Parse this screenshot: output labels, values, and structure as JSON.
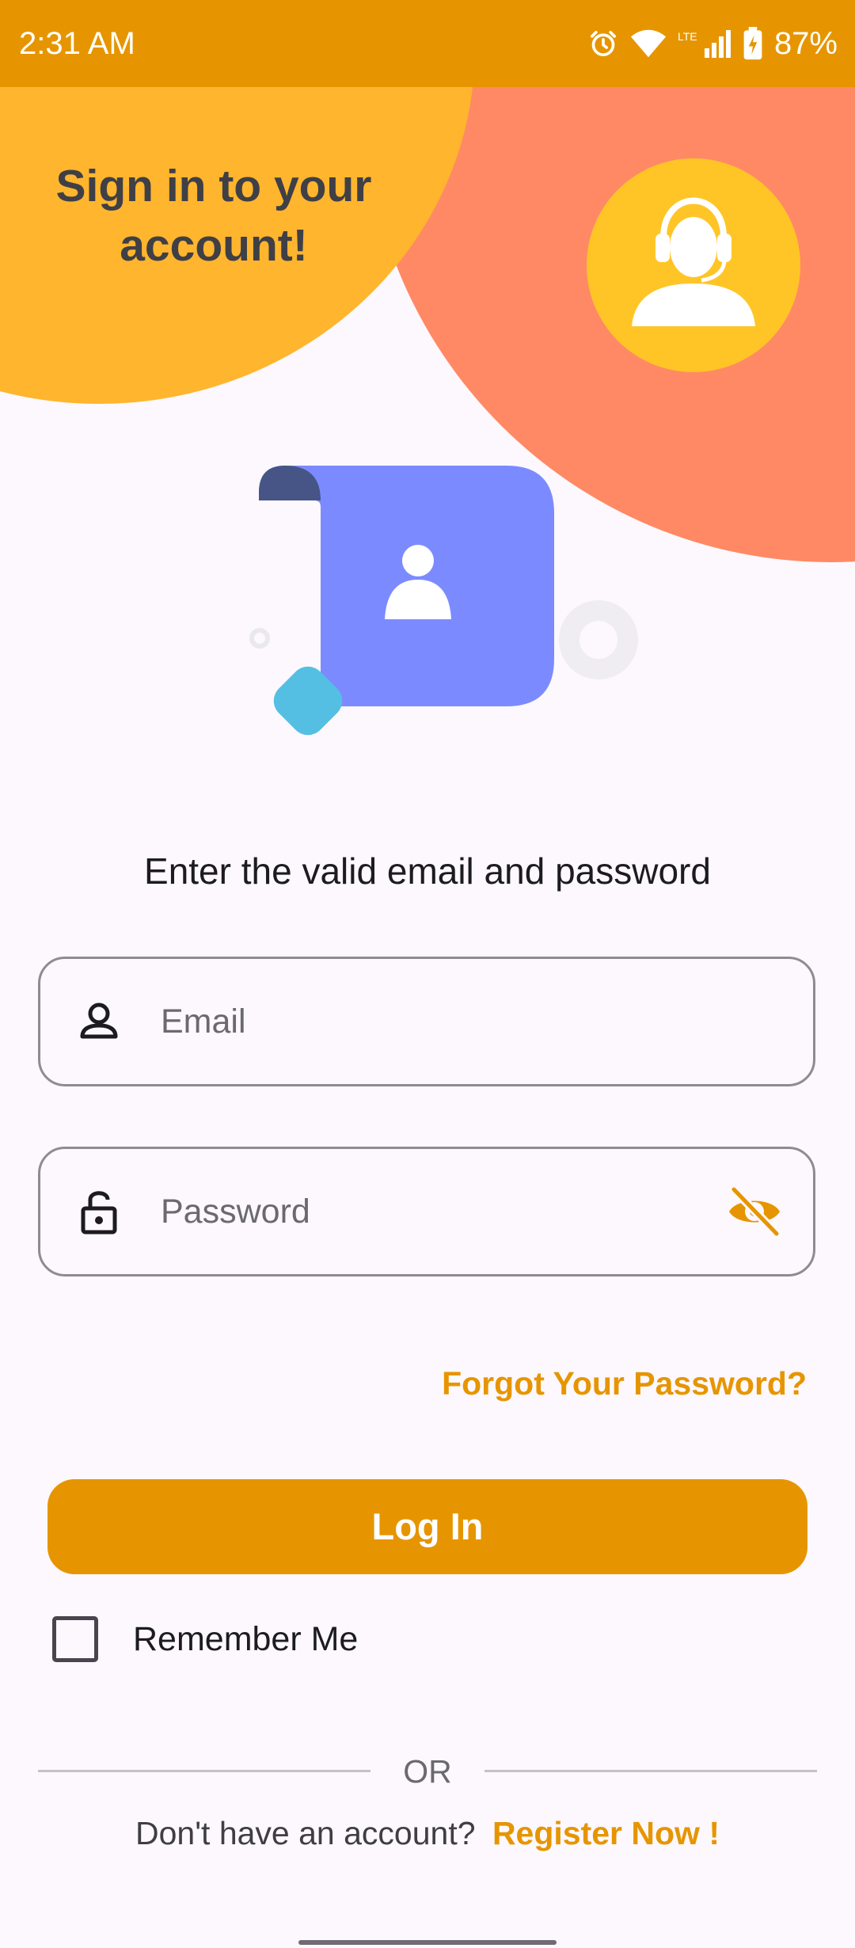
{
  "status_bar": {
    "time": "2:31 AM",
    "network_label": "LTE",
    "battery_percent": "87%",
    "icons": [
      "alarm-icon",
      "wifi-icon",
      "cell-signal-icon",
      "battery-charging-icon"
    ]
  },
  "header": {
    "title": "Sign in to your\naccount!",
    "avatar_icon": "customer-support-headset-icon"
  },
  "illustration": {
    "icon": "user-profile-document-icon"
  },
  "form": {
    "instruction": "Enter the valid email and password",
    "email": {
      "placeholder": "Email",
      "value": "",
      "icon": "person-outline-icon"
    },
    "password": {
      "placeholder": "Password",
      "value": "",
      "icon": "lock-open-icon",
      "toggle_icon": "visibility-off-icon"
    },
    "forgot_password": "Forgot Your Password?",
    "login_label": "Log In",
    "remember_me": {
      "label": "Remember Me",
      "checked": false
    }
  },
  "footer": {
    "or_label": "OR",
    "register_prompt": "Don't have an account?",
    "register_link": "Register Now !"
  },
  "colors": {
    "accent": "#E69500",
    "header_yellow": "#FFB52E",
    "header_coral": "#FF8964",
    "avatar_yellow": "#FFC527",
    "illustration_blue": "#7B8BFF",
    "illustration_cyan": "#55BFE3",
    "background": "#FCF8FD"
  }
}
